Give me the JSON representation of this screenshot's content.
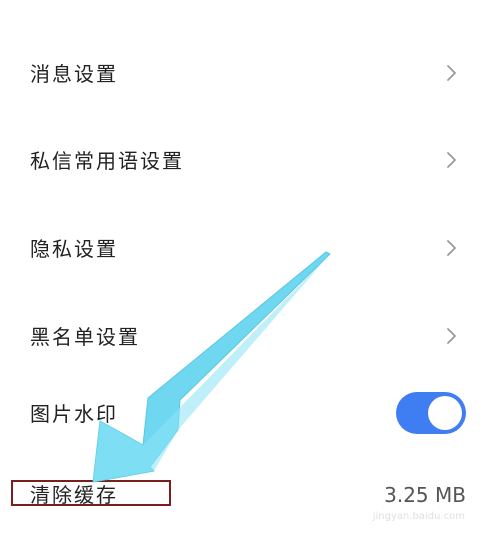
{
  "settings": {
    "items": [
      {
        "label": "消息设置",
        "control": "chevron-right-icon"
      },
      {
        "label": "私信常用语设置",
        "control": "chevron-right-icon"
      },
      {
        "label": "隐私设置",
        "control": "chevron-right-icon"
      },
      {
        "label": "黑名单设置",
        "control": "chevron-right-icon"
      },
      {
        "label": "图片水印",
        "control": "toggle",
        "toggle_on": true
      },
      {
        "label": "清除缓存",
        "value": "3.25 MB"
      }
    ]
  },
  "colors": {
    "toggle_on": "#3f7ef2",
    "arrow": "#6fd8f0",
    "highlight_border": "#7a1f1f"
  },
  "watermark": "jingyan.baidu.com"
}
